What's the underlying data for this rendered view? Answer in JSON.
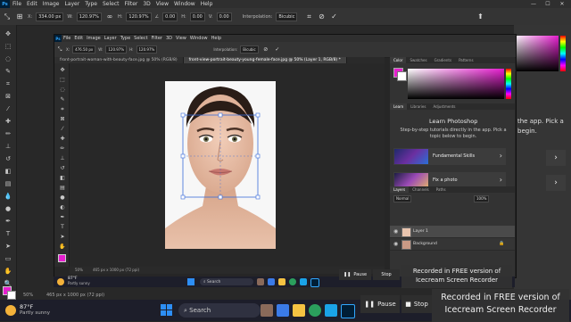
{
  "menu": {
    "logo": "Ps",
    "items": [
      "File",
      "Edit",
      "Image",
      "Layer",
      "Type",
      "Select",
      "Filter",
      "3D",
      "View",
      "Window",
      "Help"
    ]
  },
  "options": {
    "x_label": "X:",
    "x_value": "334.00 px",
    "w_label": "W:",
    "w_value": "120.97%",
    "h_label": "H:",
    "h_value": "120.97%",
    "angle_value": "0.00",
    "h2_value": "0.00",
    "v_value": "0.00",
    "interp_label": "Interpolation:",
    "interp_value": "Bicubic"
  },
  "inner": {
    "options": {
      "x_label": "X:",
      "x_value": "476.50 px",
      "w_label": "W:",
      "w_value": "120.97%",
      "h_label": "H:",
      "h_value": "120.97%",
      "interp_label": "Interpolation:",
      "interp_value": "Bicubic"
    },
    "tabs": [
      "front-portrait-woman-with-beauty-face.jpg @ 50% (RGB/8)",
      "front-view-portrait-beauty-young-female-face.jpg @ 50% (Layer 1, RGB/8) *"
    ],
    "status_zoom": "50%",
    "status_doc": "465 px x 1000 px (72 ppi)"
  },
  "panels": {
    "color_tabs": [
      "Color",
      "Swatches",
      "Gradients",
      "Patterns"
    ],
    "learn_tabs": [
      "Learn",
      "Libraries",
      "Adjustments"
    ],
    "learn_title": "Learn Photoshop",
    "learn_body": "Step-by-step tutorials directly in the app. Pick a topic below to begin.",
    "cards": [
      {
        "label": "Fundamental Skills",
        "arrow": "›"
      },
      {
        "label": "Fix a photo",
        "arrow": "›"
      }
    ],
    "layers_tabs": [
      "Layers",
      "Channels",
      "Paths"
    ],
    "blend_mode": "Normal",
    "opacity": "100%",
    "layers": [
      {
        "name": "Layer 1",
        "selected": true
      },
      {
        "name": "Background",
        "selected": false
      }
    ]
  },
  "outer_right": {
    "text1": "the app. Pick a",
    "text2": "begin.",
    "arrow": "›"
  },
  "outer_status": {
    "zoom": "50%",
    "doc": "465 px x 1000 px (72 ppi)"
  },
  "taskbar": {
    "weather_temp": "87°F",
    "weather_desc": "Partly sunny",
    "search": "Search"
  },
  "recorder": {
    "line1": "Recorded in FREE version of",
    "line2": "Icecream  Screen  Recorder",
    "pause": "Pause",
    "stop": "Stop"
  },
  "colors": {
    "accent_magenta": "#e61ecf",
    "ps_blue": "#31a8ff"
  }
}
